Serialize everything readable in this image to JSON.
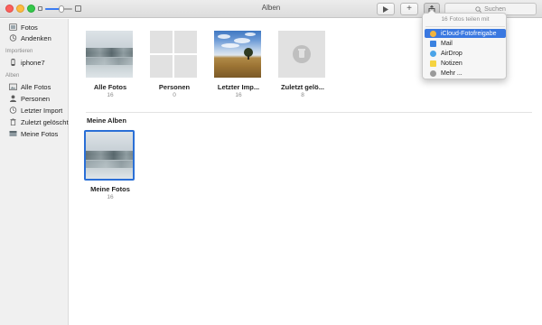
{
  "window": {
    "title": "Alben"
  },
  "toolbar": {
    "search_placeholder": "Suchen",
    "add_label": "+",
    "zoom_level": 0.6
  },
  "sidebar": {
    "top_items": [
      {
        "label": "Fotos",
        "icon": "photos-library-icon"
      },
      {
        "label": "Andenken",
        "icon": "memories-icon"
      }
    ],
    "import_section": "Importieren",
    "import_items": [
      {
        "label": "iphone7",
        "icon": "iphone-icon"
      }
    ],
    "albums_section": "Alben",
    "album_items": [
      {
        "label": "Alle Fotos",
        "icon": "all-photos-icon"
      },
      {
        "label": "Personen",
        "icon": "person-icon"
      },
      {
        "label": "Letzter Import",
        "icon": "clock-icon"
      },
      {
        "label": "Zuletzt gelöscht",
        "icon": "trash-icon"
      },
      {
        "label": "Meine Fotos",
        "icon": "album-icon"
      }
    ]
  },
  "content": {
    "albums": [
      {
        "label": "Alle Fotos",
        "count": "16"
      },
      {
        "label": "Personen",
        "count": "0"
      },
      {
        "label": "Letzter Imp...",
        "count": "16"
      },
      {
        "label": "Zuletzt gelö...",
        "count": "8"
      }
    ],
    "my_albums_title": "Meine Alben",
    "my_albums": [
      {
        "label": "Meine Fotos",
        "count": "16"
      }
    ]
  },
  "share_menu": {
    "header": "16 Fotos teilen mit",
    "items": [
      {
        "label": "iCloud-Fotofreigabe",
        "icon": "icloud-photo-sharing-icon",
        "color": "#f2b33d"
      },
      {
        "label": "Mail",
        "icon": "mail-icon",
        "color": "#3b82e0"
      },
      {
        "label": "AirDrop",
        "icon": "airdrop-icon",
        "color": "#4aa3e8"
      },
      {
        "label": "Notizen",
        "icon": "notes-icon",
        "color": "#f5d340"
      },
      {
        "label": "Mehr ...",
        "icon": "more-icon",
        "color": "#9a9a9a"
      }
    ]
  },
  "colors": {
    "accent": "#3a78e0",
    "sidebar_bg": "#f0f0f0"
  }
}
